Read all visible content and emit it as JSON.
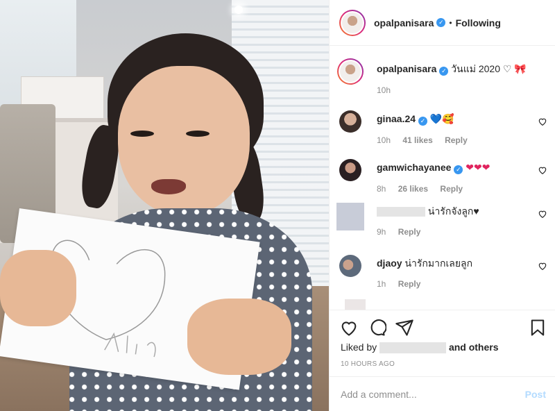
{
  "post": {
    "author": "opalpanisara",
    "follow_status": "Following",
    "dot": "•",
    "caption_author": "opalpanisara",
    "caption": "วันแม่ 2020 ♡",
    "caption_time": "10h",
    "liked_by_prefix": "Liked by",
    "liked_by_suffix": "and others",
    "time_ago": "10 HOURS AGO",
    "add_comment_placeholder": "Add a comment...",
    "post_label": "Post"
  },
  "comments": [
    {
      "user": "ginaa.24",
      "text": "💙🥰",
      "time": "10h",
      "likes": "41 likes",
      "reply": "Reply"
    },
    {
      "user": "gamwichayanee",
      "text": "❤❤❤",
      "time": "8h",
      "likes": "26 likes",
      "reply": "Reply"
    },
    {
      "user": "",
      "text": "น่ารักจังลูก♥",
      "time": "9h",
      "reply": "Reply"
    },
    {
      "user": "djaoy",
      "text": "น่ารักมากเลยลูก",
      "time": "1h",
      "reply": "Reply"
    }
  ],
  "colors": {
    "verified": "#3897f0",
    "post_button": "#b3dbff",
    "meta_grey": "#8e8e8e"
  },
  "icons": [
    "verified-badge-icon",
    "heart-icon",
    "comment-icon",
    "share-icon",
    "bookmark-icon",
    "bow-icon"
  ]
}
